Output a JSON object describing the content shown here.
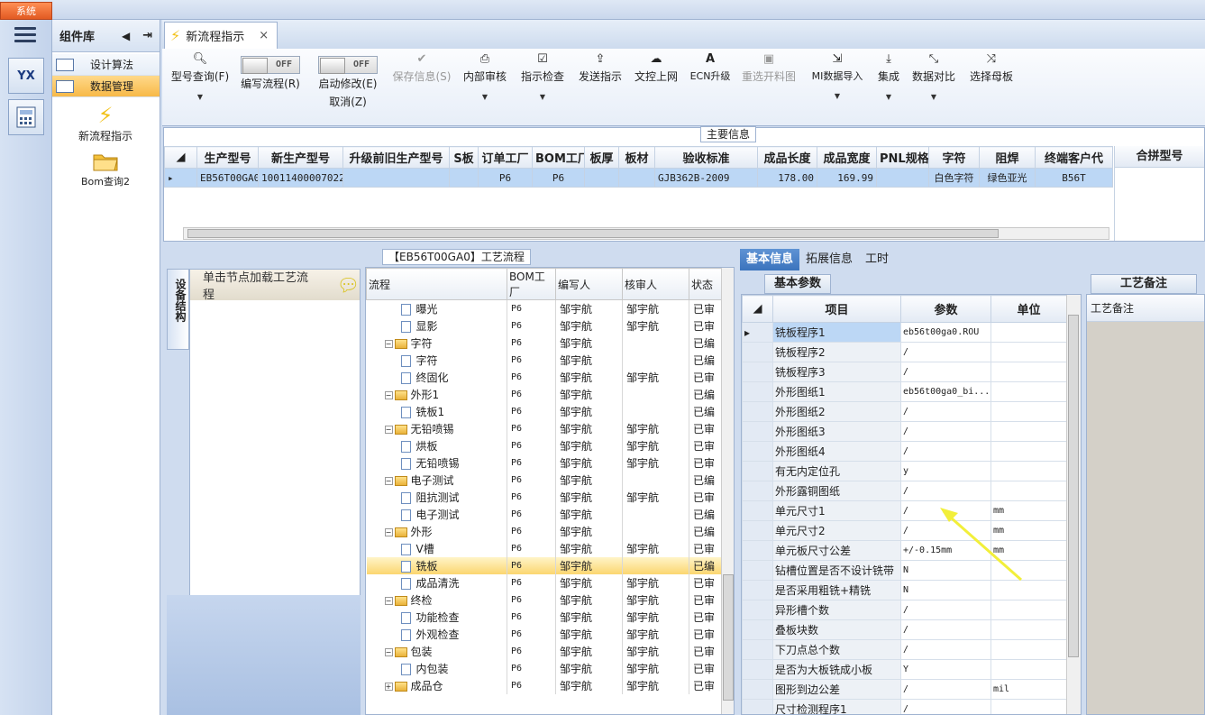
{
  "system_tab": "系统",
  "sidebar": {
    "title": "组件库",
    "items": [
      {
        "label": "设计算法",
        "selected": false
      },
      {
        "label": "数据管理",
        "selected": true
      }
    ],
    "actions": [
      {
        "label": "新流程指示",
        "icon": "lightning-icon"
      },
      {
        "label": "Bom查询2",
        "icon": "folder-icon"
      }
    ],
    "logo_text": "YX"
  },
  "doc_tab": {
    "label": "新流程指示",
    "close": "×"
  },
  "toolbar": {
    "query": "型号查询(F)",
    "edit_flow": "编写流程(R)",
    "edit_toggle": "OFF",
    "start_modify": "启动修改(E)",
    "cancel": "取消(Z)",
    "modify_toggle": "OFF",
    "save": "保存信息(S)",
    "internal_review": "内部审核",
    "check": "指示检查",
    "send": "发送指示",
    "upload": "文控上网",
    "ecn": "ECN升级",
    "reselect": "重选开料图",
    "mi_import": "MI数据导入",
    "integrate": "集成",
    "compare": "数据对比",
    "select_mother": "选择母板"
  },
  "main_info": {
    "group_label": "主要信息",
    "columns": [
      "生产型号",
      "新生产型号",
      "升级前旧生产型号",
      "S板",
      "订单工厂",
      "BOM工厂",
      "板厚",
      "板材",
      "验收标准",
      "成品长度",
      "成品宽度",
      "PNL规格",
      "字符",
      "阻焊",
      "终端客户代"
    ],
    "row": [
      "EB56T00GA0",
      "10011400007022",
      "",
      "",
      "P6",
      "P6",
      "",
      "",
      "GJB362B-2009",
      "178.00",
      "169.99",
      "",
      "白色字符",
      "绿色亚光",
      "B56T"
    ],
    "side_column": "合拼型号"
  },
  "process": {
    "group_label": "【EB56T00GA0】工艺流程",
    "left_tab": "设备结构",
    "hint": "单击节点加载工艺流程",
    "columns": [
      "流程",
      "BOM工厂",
      "编写人",
      "核审人",
      "状态"
    ],
    "rows": [
      {
        "level": 2,
        "type": "doc",
        "name": "曝光",
        "factory": "P6",
        "writer": "邹宇航",
        "reviewer": "邹宇航",
        "status": "已审"
      },
      {
        "level": 2,
        "type": "doc",
        "name": "显影",
        "factory": "P6",
        "writer": "邹宇航",
        "reviewer": "邹宇航",
        "status": "已审"
      },
      {
        "level": 1,
        "type": "folder",
        "name": "字符",
        "factory": "P6",
        "writer": "邹宇航",
        "reviewer": "",
        "status": "已编"
      },
      {
        "level": 2,
        "type": "doc",
        "name": "字符",
        "factory": "P6",
        "writer": "邹宇航",
        "reviewer": "",
        "status": "已编"
      },
      {
        "level": 2,
        "type": "doc",
        "name": "终固化",
        "factory": "P6",
        "writer": "邹宇航",
        "reviewer": "邹宇航",
        "status": "已审"
      },
      {
        "level": 1,
        "type": "folder",
        "name": "外形1",
        "factory": "P6",
        "writer": "邹宇航",
        "reviewer": "",
        "status": "已编"
      },
      {
        "level": 2,
        "type": "doc",
        "name": "铣板1",
        "factory": "P6",
        "writer": "邹宇航",
        "reviewer": "",
        "status": "已编"
      },
      {
        "level": 1,
        "type": "folder",
        "name": "无铅喷锡",
        "factory": "P6",
        "writer": "邹宇航",
        "reviewer": "邹宇航",
        "status": "已审"
      },
      {
        "level": 2,
        "type": "doc",
        "name": "烘板",
        "factory": "P6",
        "writer": "邹宇航",
        "reviewer": "邹宇航",
        "status": "已审"
      },
      {
        "level": 2,
        "type": "doc",
        "name": "无铅喷锡",
        "factory": "P6",
        "writer": "邹宇航",
        "reviewer": "邹宇航",
        "status": "已审"
      },
      {
        "level": 1,
        "type": "folder",
        "name": "电子测试",
        "factory": "P6",
        "writer": "邹宇航",
        "reviewer": "",
        "status": "已编"
      },
      {
        "level": 2,
        "type": "doc",
        "name": "阻抗测试",
        "factory": "P6",
        "writer": "邹宇航",
        "reviewer": "邹宇航",
        "status": "已审"
      },
      {
        "level": 2,
        "type": "doc",
        "name": "电子测试",
        "factory": "P6",
        "writer": "邹宇航",
        "reviewer": "",
        "status": "已编"
      },
      {
        "level": 1,
        "type": "folder",
        "name": "外形",
        "factory": "P6",
        "writer": "邹宇航",
        "reviewer": "",
        "status": "已编"
      },
      {
        "level": 2,
        "type": "doc",
        "name": "V槽",
        "factory": "P6",
        "writer": "邹宇航",
        "reviewer": "邹宇航",
        "status": "已审"
      },
      {
        "level": 2,
        "type": "doc",
        "name": "铣板",
        "factory": "P6",
        "writer": "邹宇航",
        "reviewer": "",
        "status": "已编",
        "selected": true
      },
      {
        "level": 2,
        "type": "doc",
        "name": "成品清洗",
        "factory": "P6",
        "writer": "邹宇航",
        "reviewer": "邹宇航",
        "status": "已审"
      },
      {
        "level": 1,
        "type": "folder",
        "name": "终检",
        "factory": "P6",
        "writer": "邹宇航",
        "reviewer": "邹宇航",
        "status": "已审"
      },
      {
        "level": 2,
        "type": "doc",
        "name": "功能检查",
        "factory": "P6",
        "writer": "邹宇航",
        "reviewer": "邹宇航",
        "status": "已审"
      },
      {
        "level": 2,
        "type": "doc",
        "name": "外观检查",
        "factory": "P6",
        "writer": "邹宇航",
        "reviewer": "邹宇航",
        "status": "已审"
      },
      {
        "level": 1,
        "type": "folder",
        "name": "包装",
        "factory": "P6",
        "writer": "邹宇航",
        "reviewer": "邹宇航",
        "status": "已审"
      },
      {
        "level": 2,
        "type": "doc",
        "name": "内包装",
        "factory": "P6",
        "writer": "邹宇航",
        "reviewer": "邹宇航",
        "status": "已审"
      },
      {
        "level": 1,
        "type": "folder",
        "name": "成品仓",
        "factory": "P6",
        "writer": "邹宇航",
        "reviewer": "邹宇航",
        "status": "已审",
        "collapsed": true
      }
    ]
  },
  "right_tabs": [
    "基本信息",
    "拓展信息",
    "工时"
  ],
  "params": {
    "sub_tab": "基本参数",
    "columns": [
      "项目",
      "参数",
      "单位"
    ],
    "rows": [
      [
        "铣板程序1",
        "eb56t00ga0.ROU",
        ""
      ],
      [
        "铣板程序2",
        "/",
        ""
      ],
      [
        "铣板程序3",
        "/",
        ""
      ],
      [
        "外形图纸1",
        "eb56t00ga0_bi...",
        ""
      ],
      [
        "外形图纸2",
        "/",
        ""
      ],
      [
        "外形图纸3",
        "/",
        ""
      ],
      [
        "外形图纸4",
        "/",
        ""
      ],
      [
        "有无内定位孔",
        "y",
        ""
      ],
      [
        "外形露铜图纸",
        "/",
        ""
      ],
      [
        "单元尺寸1",
        "/",
        "mm"
      ],
      [
        "单元尺寸2",
        "/",
        "mm"
      ],
      [
        "单元板尺寸公差",
        "+/-0.15mm",
        "mm"
      ],
      [
        "钻槽位置是否不设计铣带",
        "N",
        ""
      ],
      [
        "是否采用粗铣+精铣",
        "N",
        ""
      ],
      [
        "异形槽个数",
        "/",
        ""
      ],
      [
        "叠板块数",
        "/",
        ""
      ],
      [
        "下刀点总个数",
        "/",
        ""
      ],
      [
        "是否为大板铣成小板",
        "Y",
        ""
      ],
      [
        "图形到边公差",
        "/",
        "mil"
      ],
      [
        "尺寸检测程序1",
        "/",
        ""
      ]
    ]
  },
  "notes": {
    "tab": "工艺备注",
    "header": "工艺备注"
  },
  "colors": {
    "accent": "#3b73bd",
    "highlight": "#fbd670",
    "annotation_arrow": "#f2ef3a"
  }
}
